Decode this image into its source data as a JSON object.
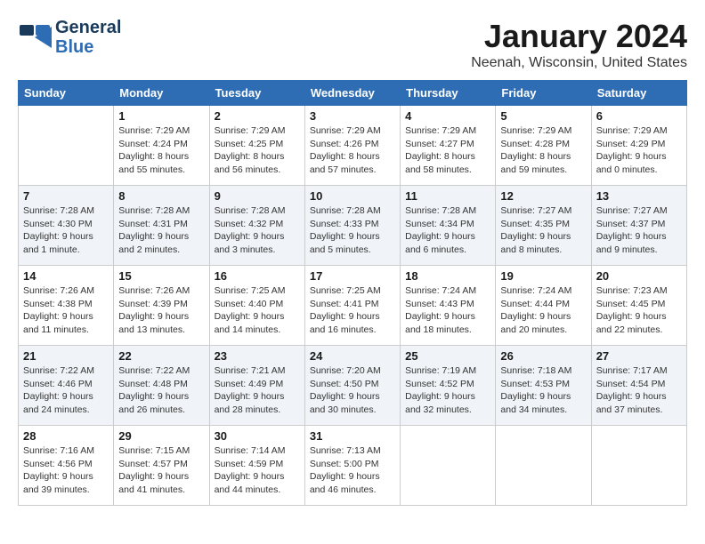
{
  "header": {
    "logo_line1": "General",
    "logo_line2": "Blue",
    "month_title": "January 2024",
    "location": "Neenah, Wisconsin, United States"
  },
  "weekdays": [
    "Sunday",
    "Monday",
    "Tuesday",
    "Wednesday",
    "Thursday",
    "Friday",
    "Saturday"
  ],
  "weeks": [
    [
      {
        "day": "",
        "info": ""
      },
      {
        "day": "1",
        "info": "Sunrise: 7:29 AM\nSunset: 4:24 PM\nDaylight: 8 hours\nand 55 minutes."
      },
      {
        "day": "2",
        "info": "Sunrise: 7:29 AM\nSunset: 4:25 PM\nDaylight: 8 hours\nand 56 minutes."
      },
      {
        "day": "3",
        "info": "Sunrise: 7:29 AM\nSunset: 4:26 PM\nDaylight: 8 hours\nand 57 minutes."
      },
      {
        "day": "4",
        "info": "Sunrise: 7:29 AM\nSunset: 4:27 PM\nDaylight: 8 hours\nand 58 minutes."
      },
      {
        "day": "5",
        "info": "Sunrise: 7:29 AM\nSunset: 4:28 PM\nDaylight: 8 hours\nand 59 minutes."
      },
      {
        "day": "6",
        "info": "Sunrise: 7:29 AM\nSunset: 4:29 PM\nDaylight: 9 hours\nand 0 minutes."
      }
    ],
    [
      {
        "day": "7",
        "info": "Sunrise: 7:28 AM\nSunset: 4:30 PM\nDaylight: 9 hours\nand 1 minute."
      },
      {
        "day": "8",
        "info": "Sunrise: 7:28 AM\nSunset: 4:31 PM\nDaylight: 9 hours\nand 2 minutes."
      },
      {
        "day": "9",
        "info": "Sunrise: 7:28 AM\nSunset: 4:32 PM\nDaylight: 9 hours\nand 3 minutes."
      },
      {
        "day": "10",
        "info": "Sunrise: 7:28 AM\nSunset: 4:33 PM\nDaylight: 9 hours\nand 5 minutes."
      },
      {
        "day": "11",
        "info": "Sunrise: 7:28 AM\nSunset: 4:34 PM\nDaylight: 9 hours\nand 6 minutes."
      },
      {
        "day": "12",
        "info": "Sunrise: 7:27 AM\nSunset: 4:35 PM\nDaylight: 9 hours\nand 8 minutes."
      },
      {
        "day": "13",
        "info": "Sunrise: 7:27 AM\nSunset: 4:37 PM\nDaylight: 9 hours\nand 9 minutes."
      }
    ],
    [
      {
        "day": "14",
        "info": "Sunrise: 7:26 AM\nSunset: 4:38 PM\nDaylight: 9 hours\nand 11 minutes."
      },
      {
        "day": "15",
        "info": "Sunrise: 7:26 AM\nSunset: 4:39 PM\nDaylight: 9 hours\nand 13 minutes."
      },
      {
        "day": "16",
        "info": "Sunrise: 7:25 AM\nSunset: 4:40 PM\nDaylight: 9 hours\nand 14 minutes."
      },
      {
        "day": "17",
        "info": "Sunrise: 7:25 AM\nSunset: 4:41 PM\nDaylight: 9 hours\nand 16 minutes."
      },
      {
        "day": "18",
        "info": "Sunrise: 7:24 AM\nSunset: 4:43 PM\nDaylight: 9 hours\nand 18 minutes."
      },
      {
        "day": "19",
        "info": "Sunrise: 7:24 AM\nSunset: 4:44 PM\nDaylight: 9 hours\nand 20 minutes."
      },
      {
        "day": "20",
        "info": "Sunrise: 7:23 AM\nSunset: 4:45 PM\nDaylight: 9 hours\nand 22 minutes."
      }
    ],
    [
      {
        "day": "21",
        "info": "Sunrise: 7:22 AM\nSunset: 4:46 PM\nDaylight: 9 hours\nand 24 minutes."
      },
      {
        "day": "22",
        "info": "Sunrise: 7:22 AM\nSunset: 4:48 PM\nDaylight: 9 hours\nand 26 minutes."
      },
      {
        "day": "23",
        "info": "Sunrise: 7:21 AM\nSunset: 4:49 PM\nDaylight: 9 hours\nand 28 minutes."
      },
      {
        "day": "24",
        "info": "Sunrise: 7:20 AM\nSunset: 4:50 PM\nDaylight: 9 hours\nand 30 minutes."
      },
      {
        "day": "25",
        "info": "Sunrise: 7:19 AM\nSunset: 4:52 PM\nDaylight: 9 hours\nand 32 minutes."
      },
      {
        "day": "26",
        "info": "Sunrise: 7:18 AM\nSunset: 4:53 PM\nDaylight: 9 hours\nand 34 minutes."
      },
      {
        "day": "27",
        "info": "Sunrise: 7:17 AM\nSunset: 4:54 PM\nDaylight: 9 hours\nand 37 minutes."
      }
    ],
    [
      {
        "day": "28",
        "info": "Sunrise: 7:16 AM\nSunset: 4:56 PM\nDaylight: 9 hours\nand 39 minutes."
      },
      {
        "day": "29",
        "info": "Sunrise: 7:15 AM\nSunset: 4:57 PM\nDaylight: 9 hours\nand 41 minutes."
      },
      {
        "day": "30",
        "info": "Sunrise: 7:14 AM\nSunset: 4:59 PM\nDaylight: 9 hours\nand 44 minutes."
      },
      {
        "day": "31",
        "info": "Sunrise: 7:13 AM\nSunset: 5:00 PM\nDaylight: 9 hours\nand 46 minutes."
      },
      {
        "day": "",
        "info": ""
      },
      {
        "day": "",
        "info": ""
      },
      {
        "day": "",
        "info": ""
      }
    ]
  ]
}
